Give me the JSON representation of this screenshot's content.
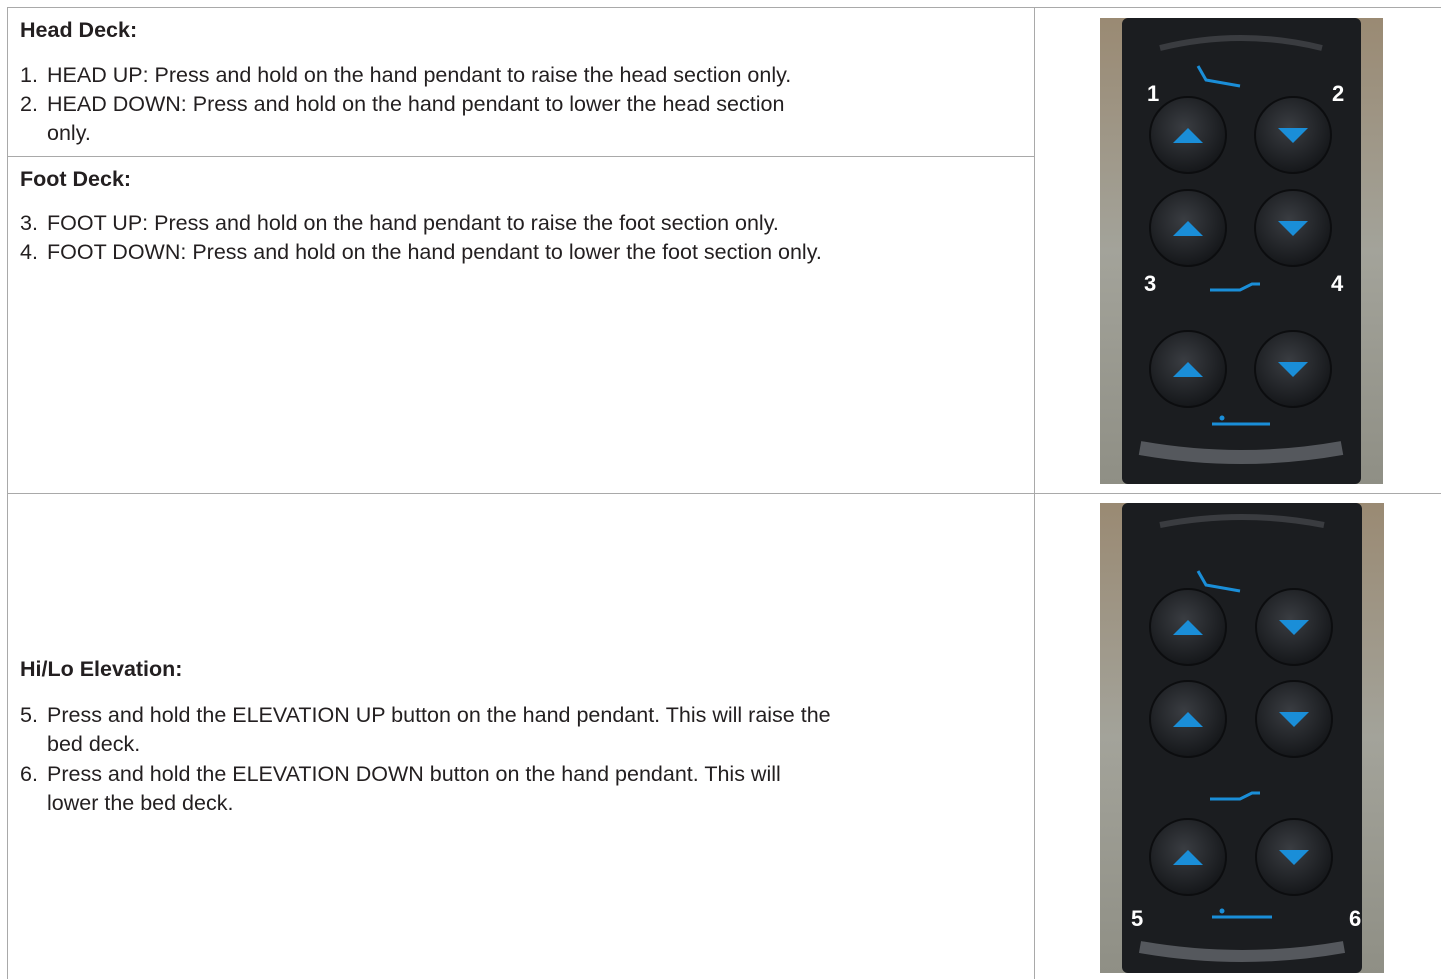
{
  "head_deck": {
    "title": "Head Deck:",
    "items": [
      {
        "num": "1.",
        "text": "HEAD UP: Press and hold on the hand pendant to raise the head section only.",
        "cont": ""
      },
      {
        "num": "2.",
        "text": "HEAD DOWN: Press and hold on the hand pendant to lower the head section",
        "cont": "only."
      }
    ]
  },
  "foot_deck": {
    "title": "Foot Deck:",
    "items": [
      {
        "num": "3.",
        "text": "FOOT UP: Press and hold on the hand pendant to raise the foot section only.",
        "cont": ""
      },
      {
        "num": "4.",
        "text": "FOOT DOWN: Press and hold on the hand pendant to lower the foot section only.",
        "cont": ""
      }
    ]
  },
  "hilo": {
    "title": "Hi/Lo Elevation:",
    "items": [
      {
        "num": "5.",
        "text": "Press and hold the ELEVATION UP button on the hand pendant. This will raise the",
        "cont": "bed deck."
      },
      {
        "num": "6.",
        "text": "Press and hold the ELEVATION DOWN button on the hand pendant. This will",
        "cont": "lower the bed deck."
      }
    ]
  },
  "photos": {
    "top_labels": [
      "1",
      "2",
      "3",
      "4"
    ],
    "bottom_labels": [
      "5",
      "6"
    ],
    "button_color": "#1a8ed8",
    "pendant_color": "#1b1d20",
    "background_color": "#8f8f85"
  }
}
